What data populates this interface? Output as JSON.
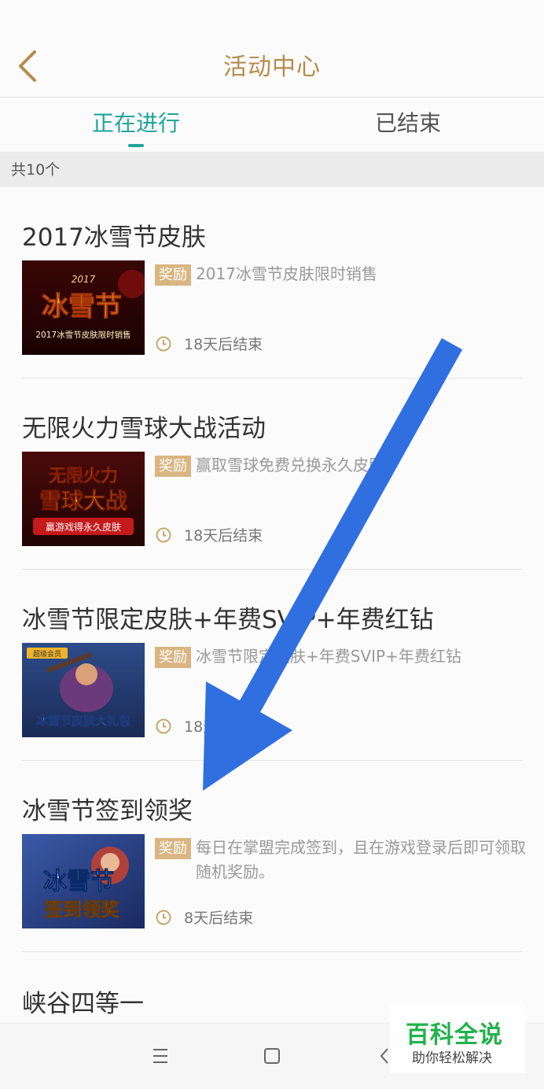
{
  "header": {
    "title": "活动中心"
  },
  "tabs": [
    {
      "label": "正在进行",
      "active": true
    },
    {
      "label": "已结束",
      "active": false
    }
  ],
  "count_label": "共10个",
  "activities": [
    {
      "title": "2017冰雪节皮肤",
      "badge": "奖励",
      "description": "2017冰雪节皮肤限时销售",
      "time": "18天后结束",
      "thumb_lines": [
        "2017",
        "冰雪节",
        "2017冰雪节皮肤限时销售"
      ]
    },
    {
      "title": "无限火力雪球大战活动",
      "badge": "奖励",
      "description": "赢取雪球免费兑换永久皮肤",
      "time": "18天后结束",
      "thumb_lines": [
        "无限火力",
        "雪球大战",
        "赢游戏得永久皮肤"
      ]
    },
    {
      "title": "冰雪节限定皮肤+年费SVIP+年费红钻",
      "badge": "奖励",
      "description": "冰雪节限定皮肤+年费SVIP+年费红钻",
      "time": "18天后结束",
      "thumb_lines": [
        "超级会员",
        "冰雪节皮肤大礼包"
      ]
    },
    {
      "title": "冰雪节签到领奖",
      "badge": "奖励",
      "description": "每日在掌盟完成签到，且在游戏登录后即可领取随机奖励。",
      "time": "8天后结束",
      "thumb_lines": [
        "冰雪节",
        "签到领奖"
      ]
    }
  ],
  "partial_item_title": "峡谷四等一",
  "watermark": {
    "main": "百科全说",
    "sub": "助你轻松解决"
  },
  "colors": {
    "accent": "#1ea59b",
    "title_gold": "#b58c4d",
    "badge": "#d9b581",
    "arrow": "#2f6fe0"
  }
}
